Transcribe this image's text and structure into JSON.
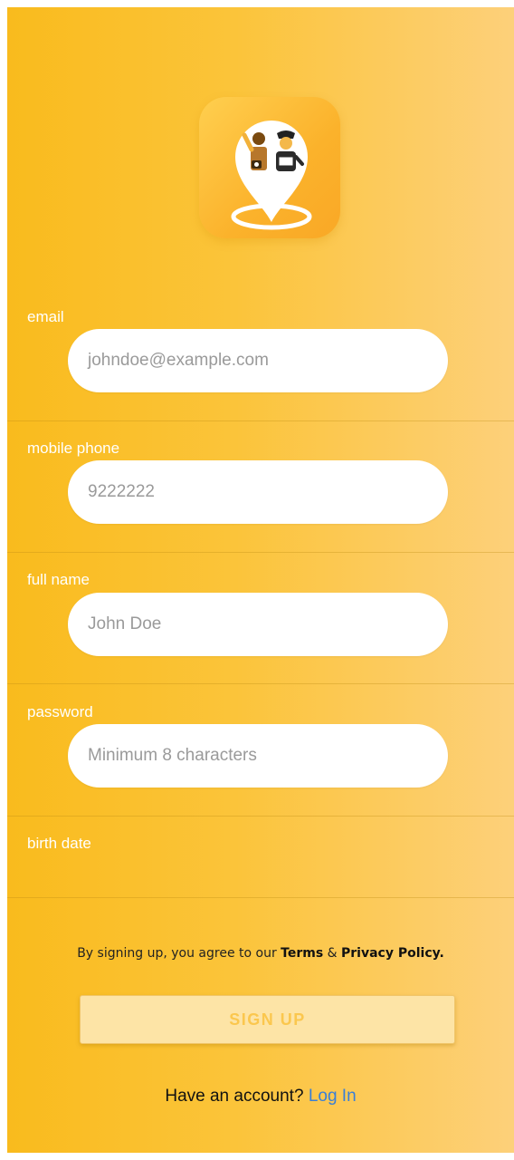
{
  "logo": {
    "icon": "tour-guide-location-pin-icon"
  },
  "form": {
    "fields": [
      {
        "label": "email",
        "placeholder": "johndoe@example.com"
      },
      {
        "label": "mobile phone",
        "placeholder": "9222222"
      },
      {
        "label": "full name",
        "placeholder": "John Doe"
      },
      {
        "label": "password",
        "placeholder": "Minimum 8 characters"
      },
      {
        "label": "birth date"
      }
    ]
  },
  "terms": {
    "prefix": "By signing up, you agree to our",
    "terms_link": "Terms",
    "amp": "&",
    "privacy_link": "Privacy Policy."
  },
  "signup_button": "SIGN UP",
  "account": {
    "prompt": "Have an account?",
    "login_link": "Log In"
  },
  "colors": {
    "accent": "#f9bb1d",
    "link": "#3a7fd6"
  }
}
